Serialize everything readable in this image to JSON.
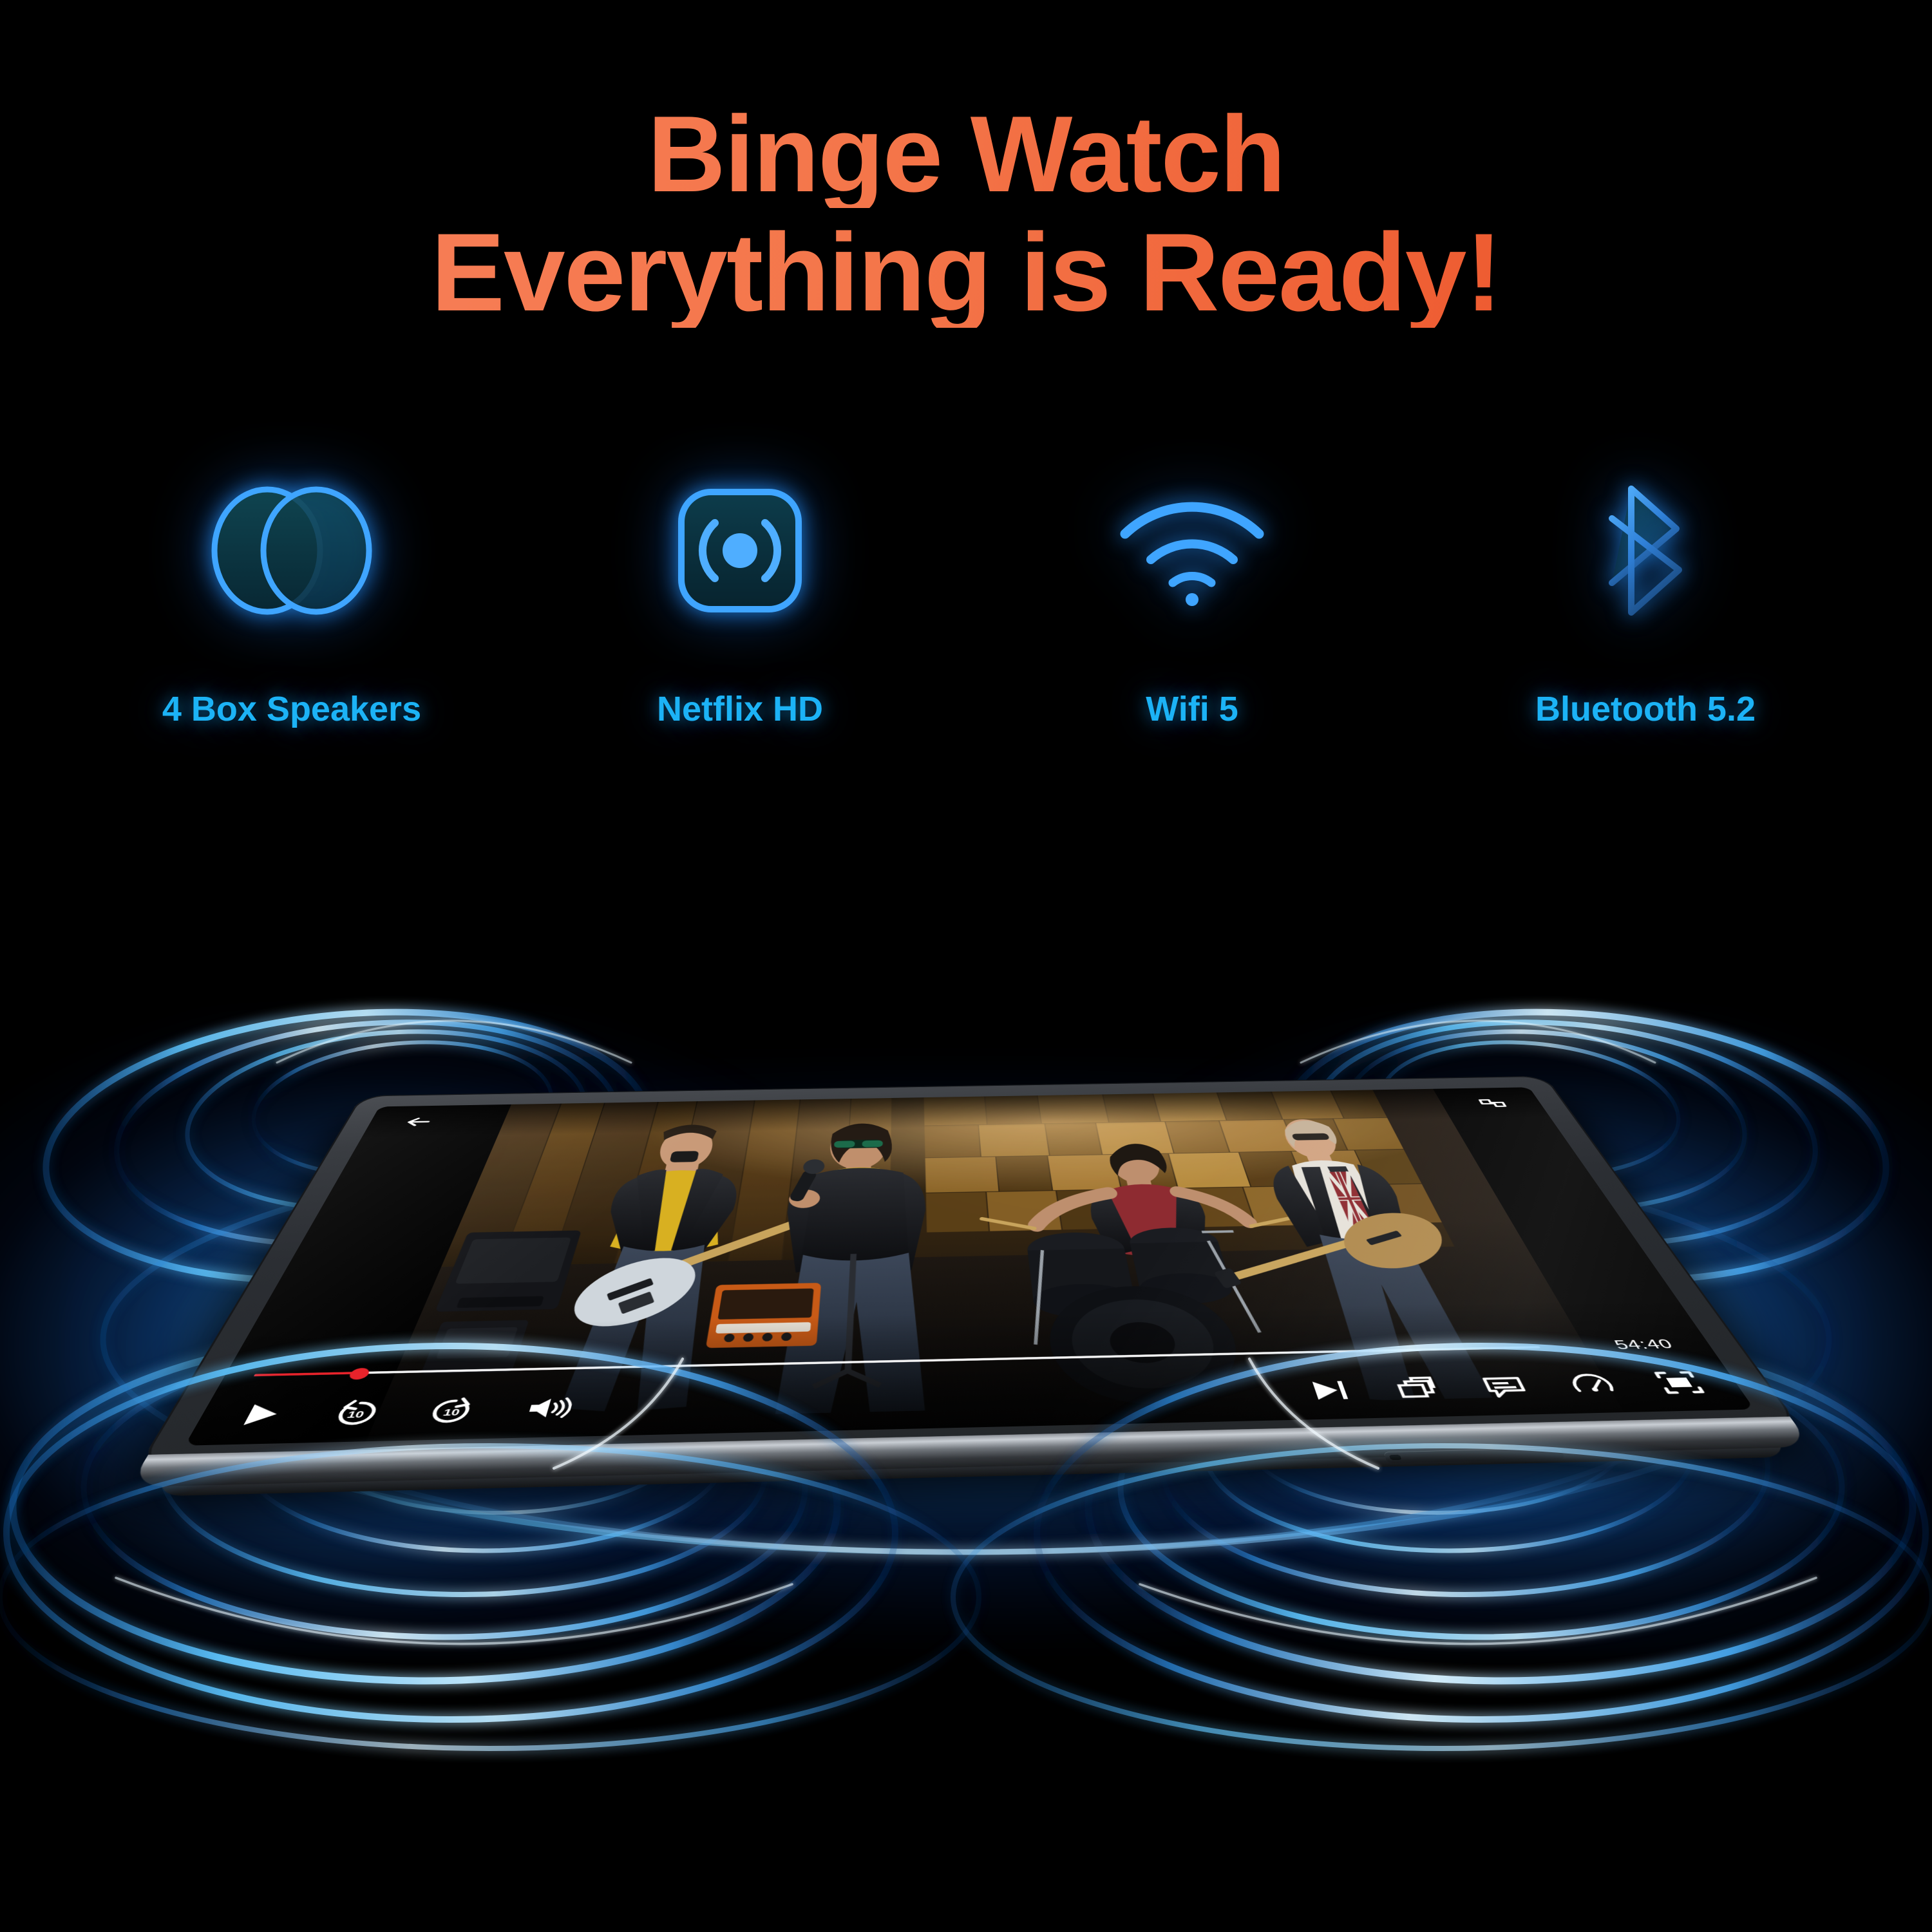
{
  "headline": {
    "line1": "Binge Watch",
    "line2": "Everything is Ready!",
    "color_start": "#F9835F",
    "color_end": "#EA4A20"
  },
  "theme": {
    "background": "#000000",
    "accent_blue": "#1CB3F6",
    "icon_stroke": "#3AA0FF",
    "icon_fill": "#0C3542",
    "glow_blue": "#2FA9FF",
    "progress_red": "#E8232B"
  },
  "features": [
    {
      "label": "4 Box Speakers",
      "icon": "overlapping-speakers-icon"
    },
    {
      "label": "Netflix HD",
      "icon": "streaming-broadcast-icon"
    },
    {
      "label": "Wifi 5",
      "icon": "wifi-icon"
    },
    {
      "label": "Bluetooth 5.2",
      "icon": "bluetooth-icon"
    }
  ],
  "device": {
    "type": "tablet",
    "orientation": "landscape",
    "has_power_button": true
  },
  "player": {
    "back_icon": "back-arrow-icon",
    "share_icon": "share-screenshot-icon",
    "time_remaining": "54:40",
    "progress_percent": 8,
    "state": "playing",
    "left_controls": [
      {
        "name": "play-button",
        "icon": "play-icon"
      },
      {
        "name": "rewind-10-button",
        "icon": "replay-10-icon",
        "label": "10"
      },
      {
        "name": "forward-10-button",
        "icon": "forward-10-icon",
        "label": "10"
      },
      {
        "name": "volume-button",
        "icon": "volume-icon"
      }
    ],
    "right_controls": [
      {
        "name": "next-track-button",
        "icon": "next-track-icon"
      },
      {
        "name": "multi-window-button",
        "icon": "multi-window-icon"
      },
      {
        "name": "subtitles-button",
        "icon": "subtitles-icon"
      },
      {
        "name": "playback-speed-button",
        "icon": "speed-gauge-icon"
      },
      {
        "name": "fullscreen-button",
        "icon": "fullscreen-icon"
      }
    ],
    "video_scene": "rock band performing on stage"
  }
}
